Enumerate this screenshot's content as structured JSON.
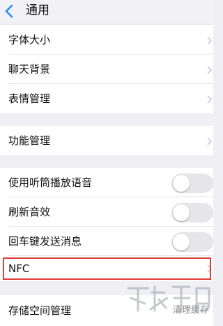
{
  "header": {
    "title": "通用"
  },
  "group1": [
    {
      "label": "字体大小"
    },
    {
      "label": "聊天背景"
    },
    {
      "label": "表情管理"
    }
  ],
  "group2": [
    {
      "label": "功能管理"
    }
  ],
  "group3": [
    {
      "label": "使用听筒播放语音",
      "enabled": false
    },
    {
      "label": "刷新音效",
      "enabled": false
    },
    {
      "label": "回车键发送消息",
      "enabled": false
    },
    {
      "label": "NFC"
    }
  ],
  "group4": [
    {
      "label": "存储空间管理",
      "action": "清理缓存"
    }
  ],
  "colors": {
    "accent": "#1f8bff",
    "highlight": "#e53935"
  }
}
